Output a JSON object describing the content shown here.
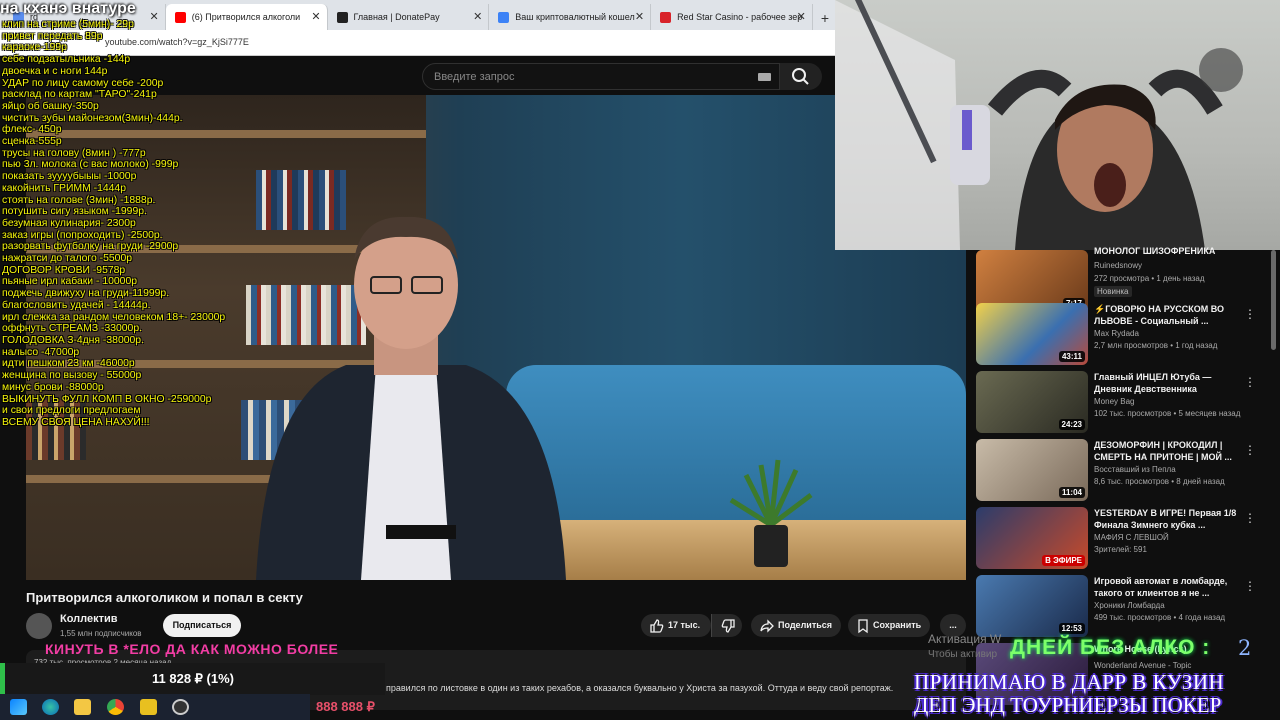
{
  "overlay": {
    "title": "на кханэ внатуре",
    "price_list": [
      "клип на стриме (5мин)- 29р",
      "привет передать 89р",
      "караоке-199р",
      "себе подзатыльника -144р",
      "двоечка и с ноги 144р",
      "УДАР по лицу самому себе -200р",
      "расклад по картам \"ТАРО\"-241р",
      "яйцо об башку-350р",
      "чистить зубы майонезом(3мин)-444р.",
      "флекс- 450р",
      "сценка-555р",
      "трусы на голову (8мин ) -777р",
      "пью 3л. молока (с вас молоко) -999р",
      "показать зуууубыыы -1000р",
      "какойнить ГРИММ -1444р",
      "стоять на голове (3мин) -1888р.",
      "потушить сигу языком -1999р.",
      "безумная кулинария- 2300р",
      "заказ игры (попроходить) -2500р.",
      "разорвать футболку на груди -2900р",
      "нажратси до талого -5500р",
      "ДОГОВОР КРОВИ -9578р",
      "пьяные ирл кабаки - 10000р",
      "поджечь движуху на груди-11999р.",
      "благословить удачей - 14444р.",
      "ирл слежка за рандом человеком 18+- 23000р",
      "оффнуть СТРЕАМЗ -33000р.",
      "ГОЛОДОВКА 3-4дня -38000р.",
      "налысо -47000р",
      "идти пешком 23 км -46000р",
      "женщина по вызову - 55000р",
      "минус брови -88000р",
      "ВЫКИНУТЬ ФУЛЛ КОМП В ОКНО -259000р",
      "и свои предлоги предлогаем",
      "ВСЕМУ СВОЯ ЦЕНА НАХУЙ!!!"
    ],
    "kinut": "КИНУТЬ В *ЕЛО ДА КАК МОЖНО БОЛЕЕ",
    "goal_amount": "11 828 ₽ (1%)",
    "money_counter": "888 888 ₽",
    "days_label": "ДНЕЙ БЕЗ АЛКО :",
    "days_count": "2",
    "banner_line1": "ПРИНИМАЮ В ДАРР В КУЗИН",
    "banner_line2": "ДЕП ЭНД ТОУРНИЕРЗЫ ПОКЕР",
    "activation_line1": "Активация W",
    "activation_line2": "Чтобы активир"
  },
  "browser": {
    "tabs": [
      {
        "label": "rd",
        "favicon_color": "#5a8dee"
      },
      {
        "label": "(6) Притворился алкоголи",
        "favicon_color": "#ff0000",
        "active": true
      },
      {
        "label": "Главная | DonatePay",
        "favicon_color": "#222222"
      },
      {
        "label": "Ваш криптовалютный кошел",
        "favicon_color": "#3c82f6"
      },
      {
        "label": "Red Star Casino - рабочее зер",
        "favicon_color": "#d8232a"
      }
    ],
    "new_tab": "+",
    "url": "youtube.com/watch?v=gz_KjSi777E"
  },
  "youtube": {
    "search_placeholder": "Введите запрос",
    "video_title": "Притворился алкоголиком и попал в секту",
    "channel_name": "Коллектив",
    "channel_subs": "1,55 млн подписчиков",
    "subscribe_label": "Подписаться",
    "likes": "17 тыс.",
    "share_label": "Поделиться",
    "save_label": "Сохранить",
    "more_label": "...",
    "views_line": "732 тыс. просмотров  2 месяца назад",
    "description": "правился по листовке в один из таких рехабов, а оказался буквально у Христа за пазухой. Оттуда и веду свой репортаж."
  },
  "related": [
    {
      "title": "МОНОЛОГ ШИЗОФРЕНИКА",
      "channel": "Ruinedsnowy",
      "meta": "272 просмотра • 1 день назад",
      "duration": "7:17",
      "badge": "Новинка",
      "thumb": "#b06a3a"
    },
    {
      "title": "⚡ГОВОРЮ НА РУССКОМ ВО ЛЬВОВЕ - Социальный ...",
      "channel": "Max Rydada",
      "meta": "2,7 млн просмотров • 1 год назад",
      "duration": "43:11",
      "thumb": "#3a6fb0"
    },
    {
      "title": "Главный ИНЦЕЛ Ютуба — Дневник Девственника",
      "channel": "Money Bag",
      "meta": "102 тыс. просмотров • 5 месяцев назад",
      "duration": "24:23",
      "thumb": "#4a4a3a"
    },
    {
      "title": "ДЕЗОМОРФИН | КРОКОДИЛ | СМЕРТЬ НА ПРИТОНЕ | МОЙ ...",
      "channel": "Восставший из Пепла",
      "meta": "8,6 тыс. просмотров • 8 дней назад",
      "duration": "11:04",
      "thumb": "#8a7a6a"
    },
    {
      "title": "YESTERDAY В ИГРЕ! Первая 1/8 Финала Зимнего кубка ...",
      "channel": "МАФИЯ С ЛЕВШОЙ",
      "meta": "Зрителей: 591",
      "duration": "В ЭФИРЕ",
      "thumb": "#2b3c6b"
    },
    {
      "title": "Игровой автомат в ломбарде, такого от клиентов я не ...",
      "channel": "Хроники Ломбарда",
      "meta": "499 тыс. просмотров • 4 года назад",
      "duration": "12:53",
      "thumb": "#3a5a8a"
    },
    {
      "title": "Whore House (Lyrics)",
      "channel": "Wonderland Avenue - Topic",
      "meta": "",
      "duration": "",
      "thumb": "#5a4a7a"
    }
  ],
  "colors": {
    "yt_bg": "#0f0f0f",
    "overlay_yellow": "#f4f40a",
    "goal_green": "#2fbf4a",
    "banner_purple": "#4d2bd1"
  }
}
